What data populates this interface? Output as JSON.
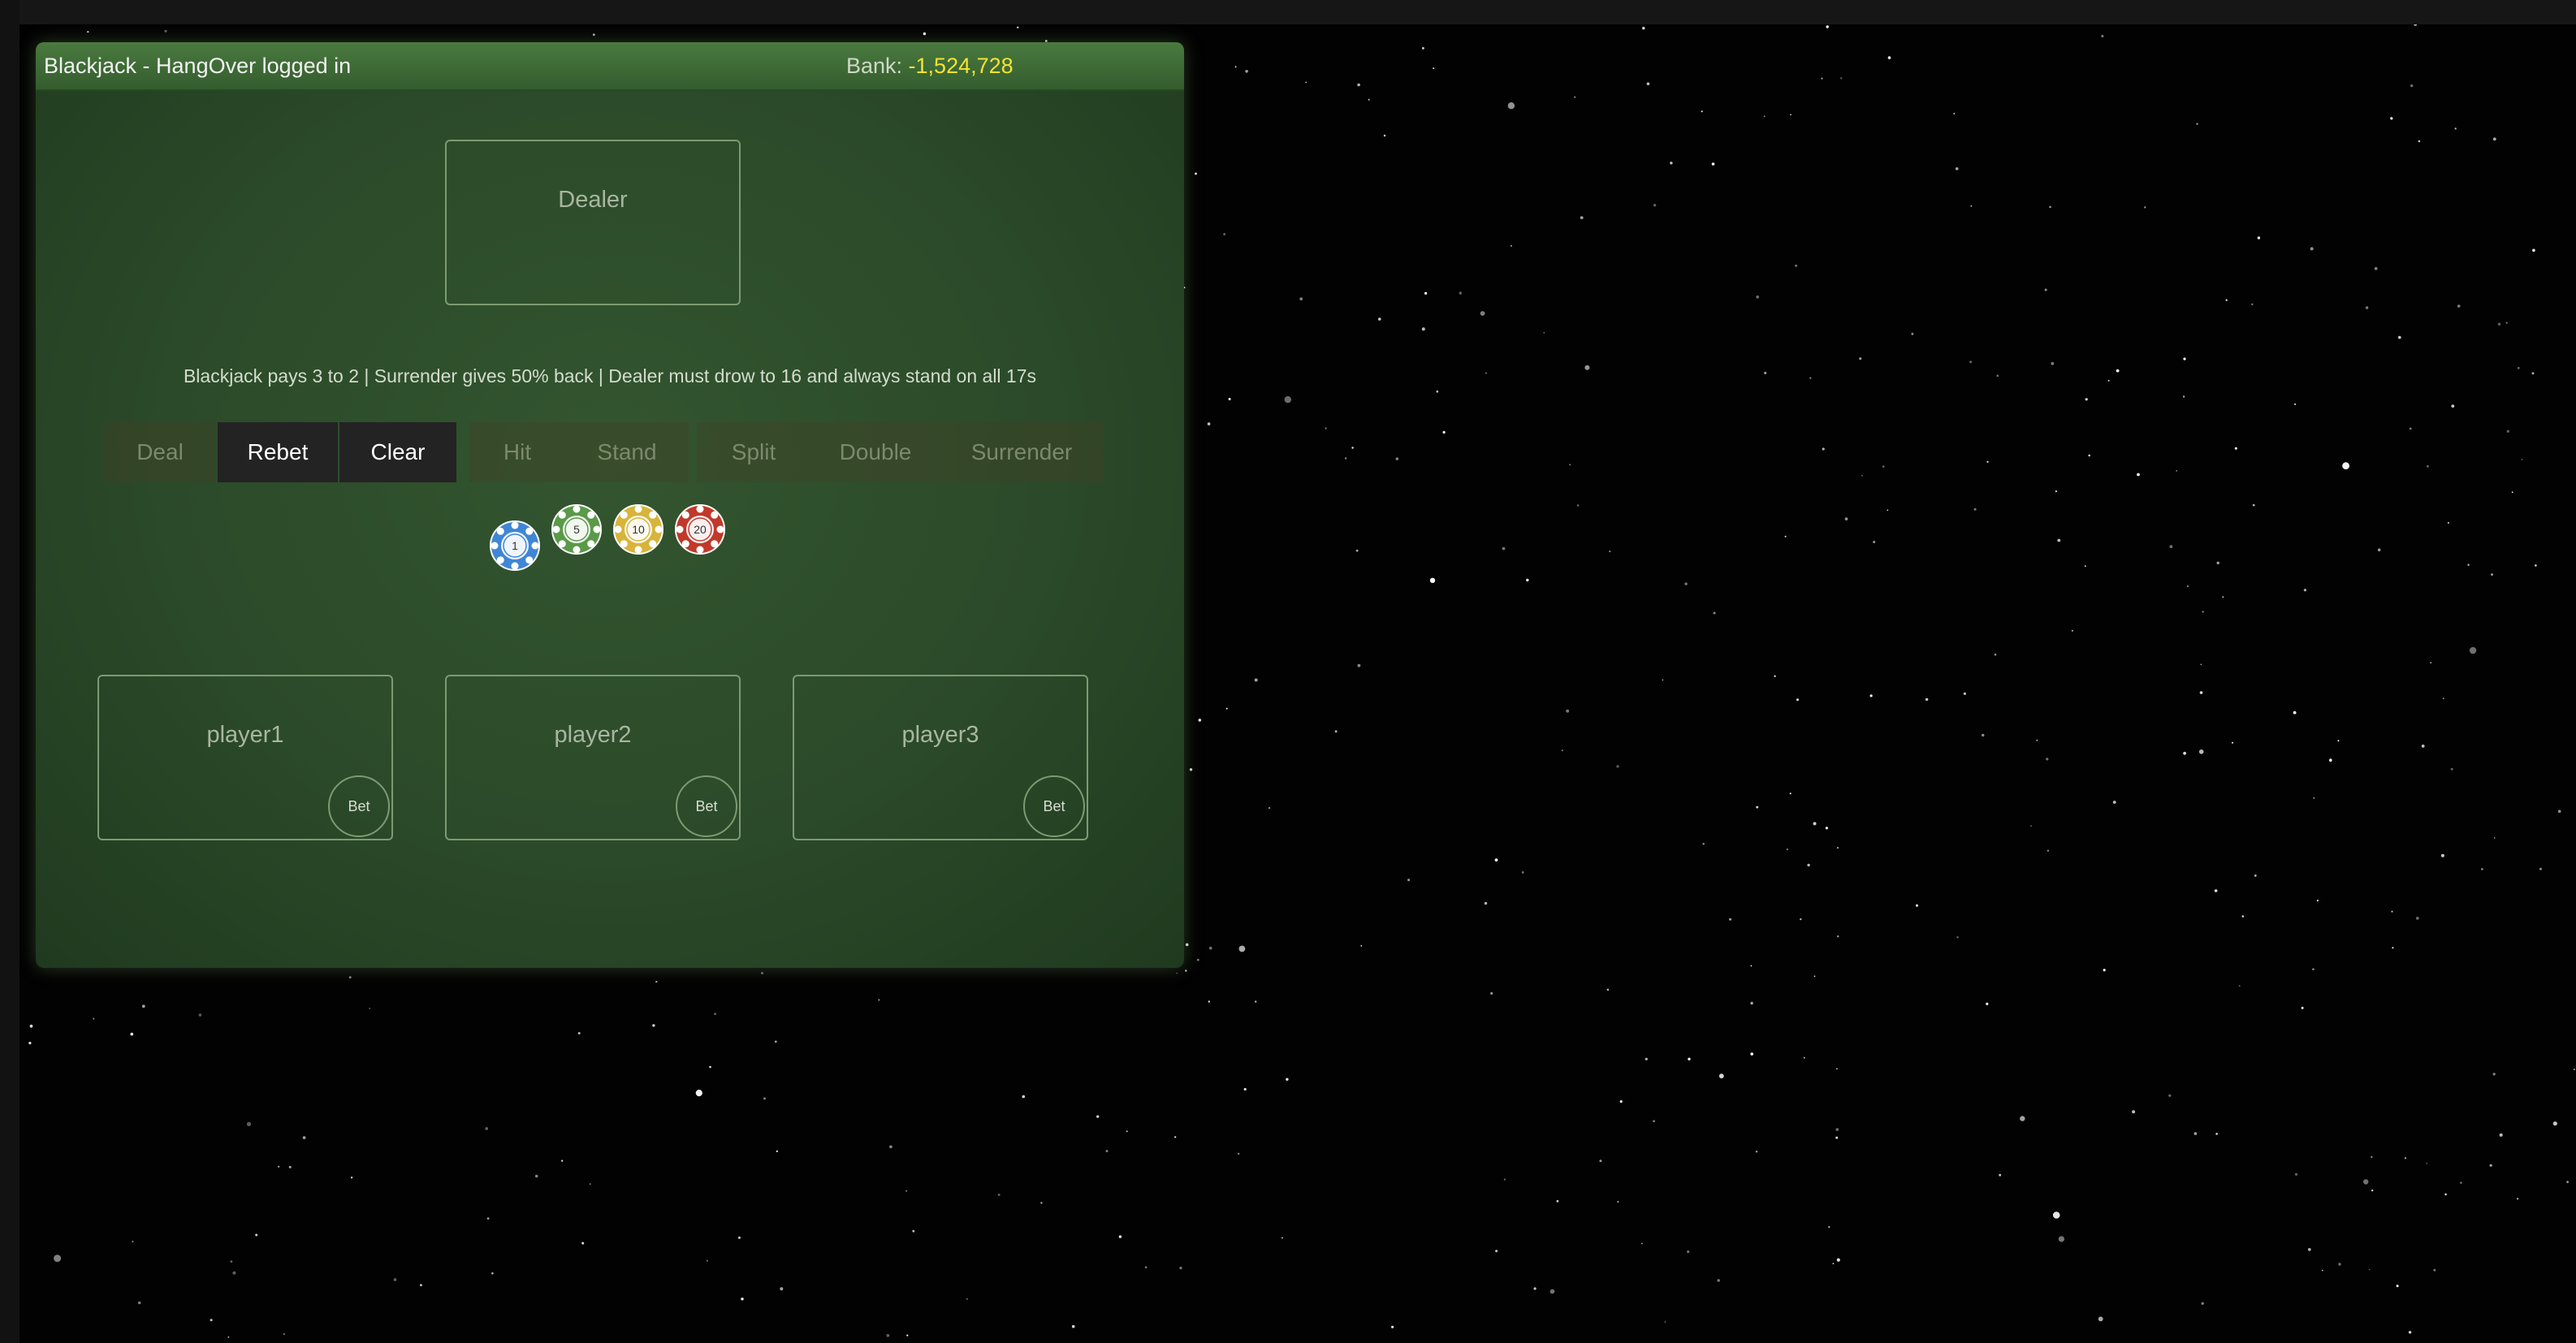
{
  "header": {
    "title": "Blackjack - HangOver logged in",
    "bank_label": "Bank: ",
    "bank_value": "-1,524,728"
  },
  "dealer": {
    "label": "Dealer"
  },
  "rules": "Blackjack pays 3 to 2 | Surrender gives 50% back | Dealer must drow to 16 and always stand on all 17s",
  "buttons": {
    "deal": "Deal",
    "rebet": "Rebet",
    "clear": "Clear",
    "hit": "Hit",
    "stand": "Stand",
    "split": "Split",
    "double": "Double",
    "surrender": "Surrender"
  },
  "chips": [
    {
      "value": "1",
      "color": "#3f86d6"
    },
    {
      "value": "5",
      "color": "#5a9a48"
    },
    {
      "value": "10",
      "color": "#d8b43a"
    },
    {
      "value": "20",
      "color": "#c0392b"
    }
  ],
  "players": [
    {
      "label": "player1",
      "bet_label": "Bet"
    },
    {
      "label": "player2",
      "bet_label": "Bet"
    },
    {
      "label": "player3",
      "bet_label": "Bet"
    }
  ],
  "colors": {
    "felt": "#2f5230",
    "titlebar": "#42703a",
    "bank_value": "#f4e232"
  }
}
